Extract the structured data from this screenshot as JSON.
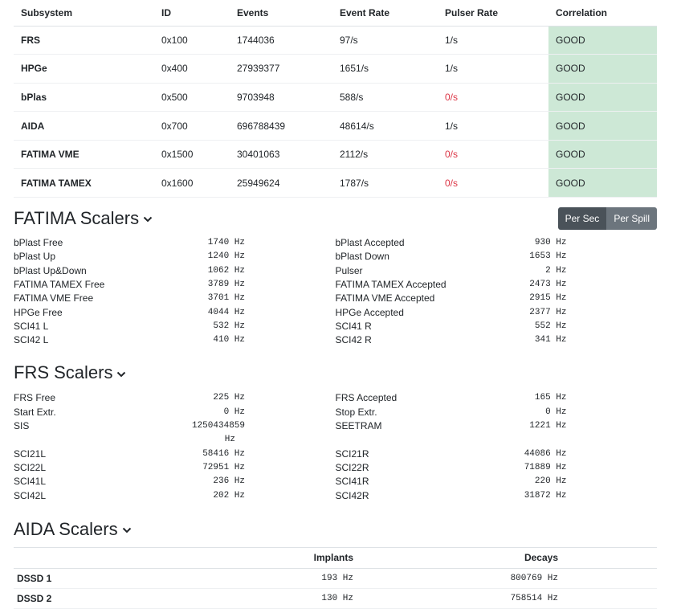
{
  "subsystems": {
    "headers": [
      "Subsystem",
      "ID",
      "Events",
      "Event Rate",
      "Pulser Rate",
      "Correlation"
    ],
    "rows": [
      {
        "name": "FRS",
        "id": "0x100",
        "events": "1744036",
        "event_rate": "97/s",
        "pulser_rate": "1/s",
        "correlation": "GOOD"
      },
      {
        "name": "HPGe",
        "id": "0x400",
        "events": "27939377",
        "event_rate": "1651/s",
        "pulser_rate": "1/s",
        "correlation": "GOOD"
      },
      {
        "name": "bPlas",
        "id": "0x500",
        "events": "9703948",
        "event_rate": "588/s",
        "pulser_rate": "0/s",
        "correlation": "GOOD"
      },
      {
        "name": "AIDA",
        "id": "0x700",
        "events": "696788439",
        "event_rate": "48614/s",
        "pulser_rate": "1/s",
        "correlation": "GOOD"
      },
      {
        "name": "FATIMA VME",
        "id": "0x1500",
        "events": "30401063",
        "event_rate": "2112/s",
        "pulser_rate": "0/s",
        "correlation": "GOOD"
      },
      {
        "name": "FATIMA TAMEX",
        "id": "0x1600",
        "events": "25949624",
        "event_rate": "1787/s",
        "pulser_rate": "0/s",
        "correlation": "GOOD"
      }
    ]
  },
  "fatima": {
    "title": "FATIMA Scalers",
    "toggle": {
      "per_sec": "Per Sec",
      "per_spill": "Per Spill"
    },
    "left": [
      {
        "label": "bPlast Free",
        "value": "1740 Hz"
      },
      {
        "label": "bPlast Up",
        "value": "1240 Hz"
      },
      {
        "label": "bPlast Up&Down",
        "value": "1062 Hz"
      },
      {
        "label": "FATIMA TAMEX Free",
        "value": "3789 Hz"
      },
      {
        "label": "FATIMA VME Free",
        "value": "3701 Hz"
      },
      {
        "label": "HPGe Free",
        "value": "4044 Hz"
      },
      {
        "label": "SCI41 L",
        "value": "532 Hz"
      },
      {
        "label": "SCI42 L",
        "value": "410 Hz"
      }
    ],
    "right": [
      {
        "label": "bPlast Accepted",
        "value": "930 Hz"
      },
      {
        "label": "bPlast Down",
        "value": "1653 Hz"
      },
      {
        "label": "Pulser",
        "value": "2 Hz"
      },
      {
        "label": "FATIMA TAMEX Accepted",
        "value": "2473 Hz"
      },
      {
        "label": "FATIMA VME Accepted",
        "value": "2915 Hz"
      },
      {
        "label": "HPGe Accepted",
        "value": "2377 Hz"
      },
      {
        "label": "SCI41 R",
        "value": "552 Hz"
      },
      {
        "label": "SCI42 R",
        "value": "341 Hz"
      }
    ]
  },
  "frs": {
    "title": "FRS Scalers",
    "left": [
      {
        "label": "FRS Free",
        "value": "225 Hz"
      },
      {
        "label": "Start Extr.",
        "value": "0 Hz"
      },
      {
        "label": "SIS",
        "value": "1250434859",
        "unit": "Hz"
      },
      {
        "label": "SCI21L",
        "value": "58416 Hz"
      },
      {
        "label": "SCI22L",
        "value": "72951 Hz"
      },
      {
        "label": "SCI41L",
        "value": "236 Hz"
      },
      {
        "label": "SCI42L",
        "value": "202 Hz"
      }
    ],
    "right": [
      {
        "label": "FRS Accepted",
        "value": "165 Hz"
      },
      {
        "label": "Stop Extr.",
        "value": "0 Hz"
      },
      {
        "label": "SEETRAM",
        "value": "1221 Hz"
      },
      {
        "label": "SCI21R",
        "value": "44086 Hz"
      },
      {
        "label": "SCI22R",
        "value": "71889 Hz"
      },
      {
        "label": "SCI41R",
        "value": "220 Hz"
      },
      {
        "label": "SCI42R",
        "value": "31872 Hz"
      }
    ]
  },
  "aida": {
    "title": "AIDA Scalers",
    "headers": {
      "implants": "Implants",
      "decays": "Decays"
    },
    "rows": [
      {
        "name": "DSSD 1",
        "implants": "193 Hz",
        "decays": "800769 Hz"
      },
      {
        "name": "DSSD 2",
        "implants": "130 Hz",
        "decays": "758514 Hz"
      }
    ]
  },
  "icons": {
    "section_toggle": "chevron-down-icon"
  }
}
